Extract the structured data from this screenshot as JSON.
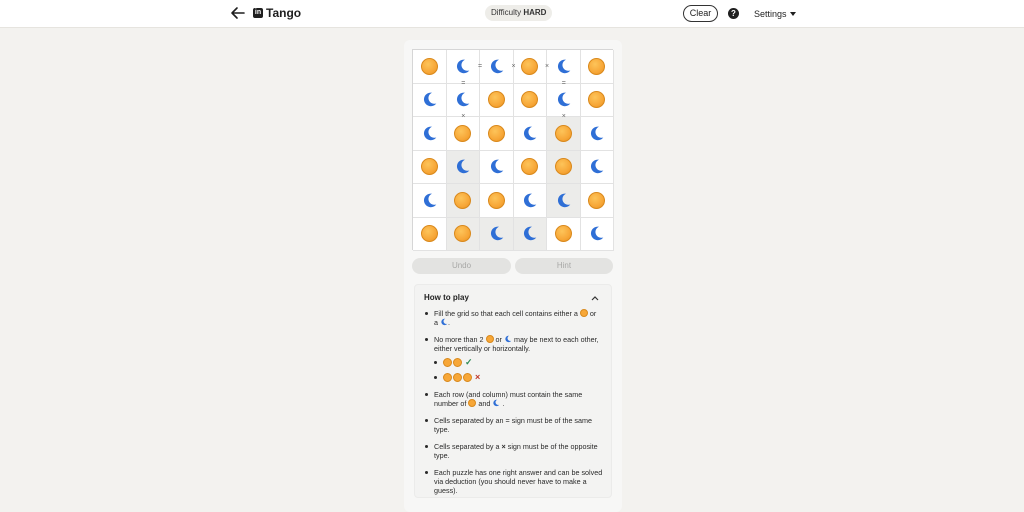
{
  "header": {
    "app_title": "Tango",
    "logo_text": "in",
    "difficulty_label": "Difficulty",
    "difficulty_value": "HARD",
    "clear_label": "Clear",
    "help_label": "?",
    "settings_label": "Settings"
  },
  "grid": {
    "rows": [
      [
        "sun",
        "moon",
        "moon",
        "sun",
        "moon",
        "sun"
      ],
      [
        "moon",
        "moon",
        "sun",
        "sun",
        "moon",
        "sun"
      ],
      [
        "moon",
        "sun",
        "sun",
        "moon",
        "sun",
        "moon"
      ],
      [
        "sun",
        "moon",
        "moon",
        "sun",
        "sun",
        "moon"
      ],
      [
        "moon",
        "sun",
        "sun",
        "moon",
        "moon",
        "sun"
      ],
      [
        "sun",
        "sun",
        "moon",
        "moon",
        "sun",
        "moon"
      ]
    ],
    "colors": {
      "sun": "#f7a738",
      "moon": "#2f6fd6",
      "shade": "#ececea"
    },
    "constraints": [
      {
        "type": "=",
        "between": "r1c2-r1c3"
      },
      {
        "type": "×",
        "between": "r1c3-r1c4"
      },
      {
        "type": "×",
        "between": "r1c4-r1c5"
      },
      {
        "type": "=",
        "between": "r1c2-r2c2"
      },
      {
        "type": "=",
        "between": "r1c5-r2c5"
      },
      {
        "type": "×",
        "between": "r2c2-r3c2"
      },
      {
        "type": "×",
        "between": "r2c5-r3c5"
      }
    ]
  },
  "controls": {
    "undo_label": "Undo",
    "hint_label": "Hint"
  },
  "how_to_play": {
    "title": "How to play",
    "rule1_a": "Fill the grid so that each cell contains either a",
    "rule1_b": "or",
    "rule1_c": "a",
    "rule1_d": ".",
    "rule2_a": "No more than 2",
    "rule2_b": "or",
    "rule2_c": "may be next to each other, either vertically or horizontally.",
    "ok_mark": "✓",
    "bad_mark": "×",
    "rule3_a": "Each row (and column) must contain the same number of",
    "rule3_b": "and",
    "rule3_c": ".",
    "rule4": "Cells separated by an = sign must be of the same type.",
    "rule5_a": "Cells separated by a",
    "rule5_x": "×",
    "rule5_b": "sign must be of the opposite type.",
    "rule6": "Each puzzle has one right answer and can be solved via deduction (you should never have to make a guess)."
  }
}
